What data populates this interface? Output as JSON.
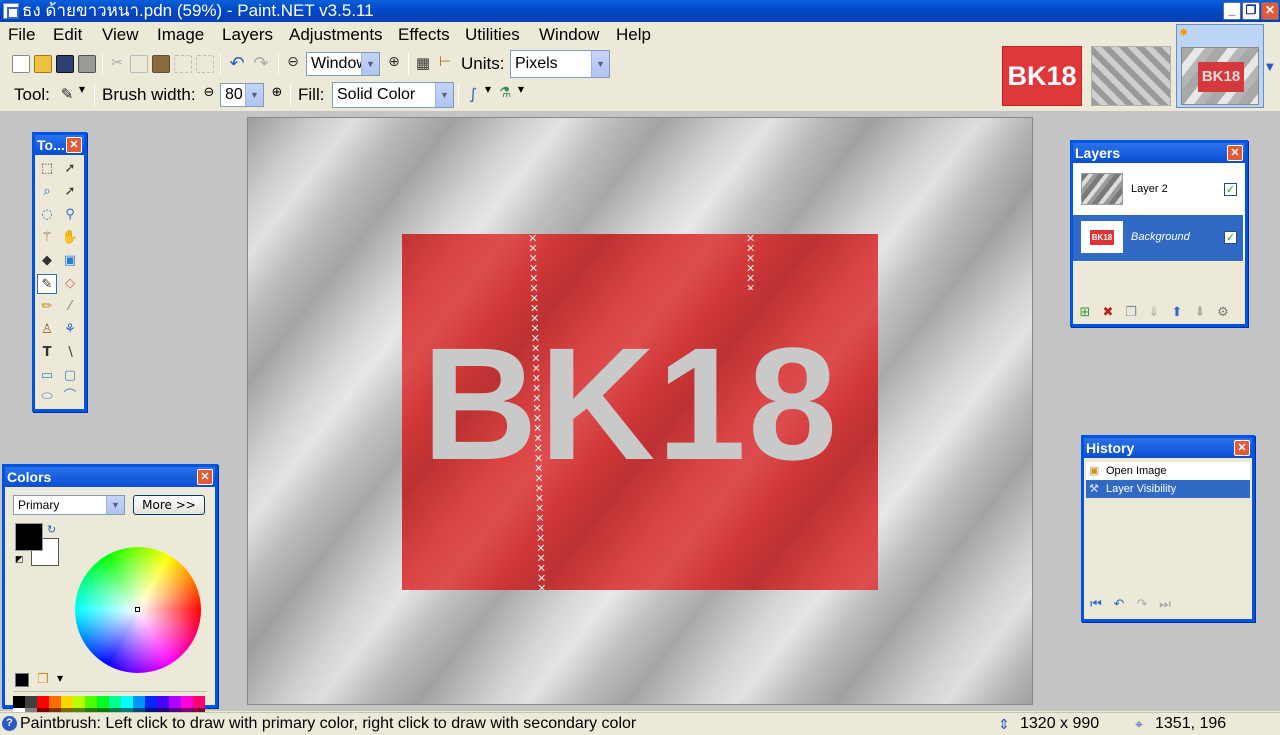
{
  "window": {
    "title": "ธง ด้ายขาวหนา.pdn (59%) - Paint.NET v3.5.11",
    "minimize": "_",
    "restore": "❐",
    "close": "✕"
  },
  "menu": [
    "File",
    "Edit",
    "View",
    "Image",
    "Layers",
    "Adjustments",
    "Effects",
    "Utilities",
    "Window",
    "Help"
  ],
  "toolbar": {
    "zoom_value": "Window",
    "units_label": "Units:",
    "units_value": "Pixels",
    "tool_label": "Tool:",
    "brush_width_label": "Brush width:",
    "brush_width_value": "80",
    "fill_label": "Fill:",
    "fill_value": "Solid Color"
  },
  "thumbnails": [
    {
      "label": "BK18",
      "kind": "red"
    },
    {
      "label": "",
      "kind": "checker"
    },
    {
      "label": "BK18",
      "kind": "flag",
      "active": true
    }
  ],
  "canvas": {
    "text": "BK18",
    "stitch": "✕"
  },
  "tools_window": {
    "title": "To...",
    "icons": [
      "rectangle-select-icon",
      "move-selection-icon",
      "lasso-select-icon",
      "move-selected-icon",
      "ellipse-select-icon",
      "zoom-icon",
      "magic-wand-icon",
      "pan-icon",
      "paint-bucket-icon",
      "gradient-icon",
      "paintbrush-icon",
      "eraser-icon",
      "pencil-icon",
      "color-picker-icon",
      "clone-stamp-icon",
      "recolor-icon",
      "text-icon",
      "line-curve-icon",
      "rectangle-icon",
      "rounded-rectangle-icon",
      "ellipse-icon",
      "freeform-shape-icon"
    ]
  },
  "layers_window": {
    "title": "Layers",
    "layers": [
      {
        "name": "Layer 2",
        "visible": true,
        "selected": false
      },
      {
        "name": "Background",
        "visible": true,
        "selected": true,
        "thumb_text": "BK18"
      }
    ],
    "checkmark": "✓"
  },
  "history_window": {
    "title": "History",
    "items": [
      {
        "label": "Open Image",
        "selected": false
      },
      {
        "label": "Layer Visibility",
        "selected": true
      }
    ]
  },
  "colors_window": {
    "title": "Colors",
    "mode": "Primary",
    "more_button": "More >>",
    "primary_color": "#000000",
    "secondary_color": "#ffffff",
    "palette": [
      "#000000",
      "#404040",
      "#ff0000",
      "#ff6a00",
      "#ffd800",
      "#b6ff00",
      "#4cff00",
      "#00ff21",
      "#00ff90",
      "#00ffff",
      "#0094ff",
      "#0026ff",
      "#4800ff",
      "#b200ff",
      "#ff00dc",
      "#ff006e",
      "#ffffff",
      "#808080",
      "#7f0000",
      "#7f3300",
      "#7f6a00",
      "#5b7f00",
      "#267f00",
      "#007f0e",
      "#007f46",
      "#007f7f",
      "#004a7f",
      "#00137f",
      "#21007f",
      "#57007f",
      "#7f006e",
      "#7f0037"
    ]
  },
  "status": {
    "message": "Paintbrush: Left click to draw with primary color, right click to draw with secondary color",
    "image_size": "1320 x 990",
    "cursor_pos": "1351, 196"
  }
}
